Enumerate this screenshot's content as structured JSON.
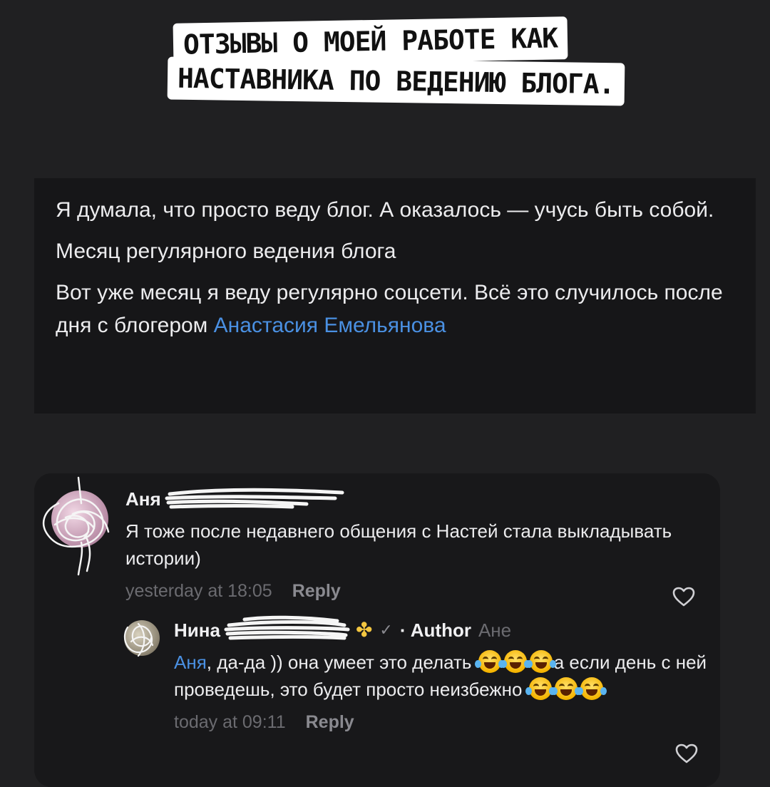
{
  "headline": {
    "line1": "ОТЗЫВЫ О МОЕЙ РАБОТЕ КАК",
    "line2": "НАСТАВНИКА ПО ВЕДЕНИЮ БЛОГА."
  },
  "quote": {
    "p1": "Я думала, что просто веду блог. А оказалось — учусь быть собой.",
    "p2": "Месяц регулярного ведения блога",
    "p3_text": "Вот уже месяц я веду регулярно соцсети. Всё это случилось после дня с блогером ",
    "p3_link": "Анастасия Емельянова"
  },
  "comments": [
    {
      "author": "Аня",
      "text": "Я тоже после недавнего общения с Настей стала выкладывать истории)",
      "time": "yesterday at 18:05",
      "reply_label": "Reply"
    },
    {
      "author": "Нина",
      "author_badge": "· Author",
      "reply_to": "Ане",
      "mention": "Аня",
      "text_a": ", да-да )) она умеет это делать ",
      "text_b": "а если день с ней проведешь, это будет просто неизбежно ",
      "time": "today at 09:11",
      "reply_label": "Reply"
    }
  ],
  "icons": {
    "heart": "heart-outline-icon",
    "clover": "four-leaf-clover-emoji",
    "check": "checkmark-icon",
    "laugh": "tears-of-joy-emoji"
  },
  "colors": {
    "background": "#202022",
    "link": "#4a90e2",
    "muted": "#6b6b70"
  }
}
